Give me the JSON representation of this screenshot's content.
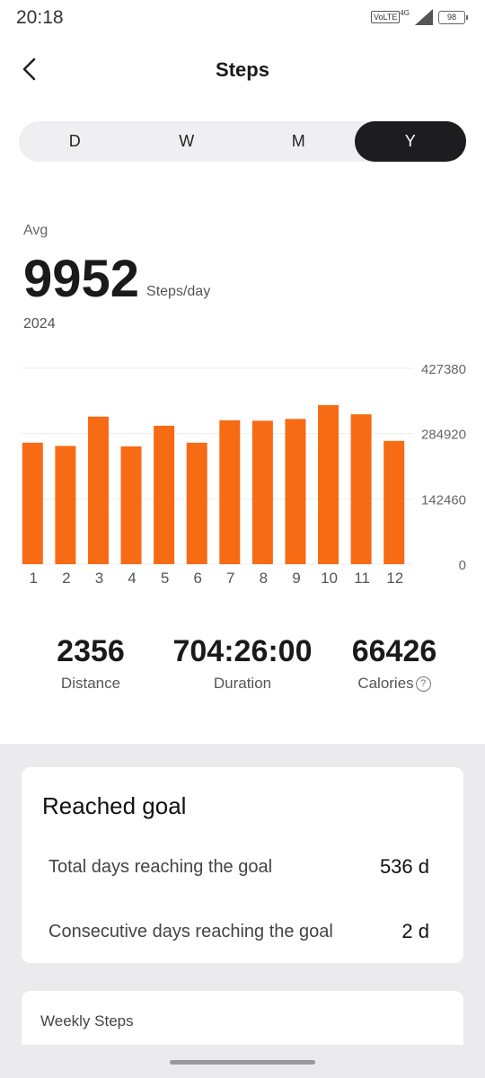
{
  "status": {
    "time": "20:18",
    "volte": "VoLTE",
    "network": "4G",
    "battery": "98"
  },
  "header": {
    "title": "Steps"
  },
  "segments": [
    {
      "label": "D",
      "active": false
    },
    {
      "label": "W",
      "active": false
    },
    {
      "label": "M",
      "active": false
    },
    {
      "label": "Y",
      "active": true
    }
  ],
  "summary": {
    "avg_label": "Avg",
    "avg_value": "9952",
    "unit": "Steps/day",
    "period": "2024"
  },
  "chart_data": {
    "type": "bar",
    "categories": [
      "1",
      "2",
      "3",
      "4",
      "5",
      "6",
      "7",
      "8",
      "9",
      "10",
      "11",
      "12"
    ],
    "values": [
      265000,
      258000,
      322000,
      257000,
      302000,
      265000,
      314000,
      313000,
      317000,
      347000,
      327000,
      269000
    ],
    "yticks": [
      "427380",
      "284920",
      "142460",
      "0"
    ],
    "ylim": [
      0,
      427380
    ],
    "grid": true,
    "bar_color": "#f76b15"
  },
  "stats": [
    {
      "value": "2356",
      "label": "Distance"
    },
    {
      "value": "704:26:00",
      "label": "Duration"
    },
    {
      "value": "66426",
      "label": "Calories",
      "help": "?"
    }
  ],
  "goal_card": {
    "title": "Reached goal",
    "rows": [
      {
        "label": "Total days reaching the goal",
        "value": "536 d"
      },
      {
        "label": "Consecutive days reaching the goal",
        "value": "2 d"
      }
    ]
  },
  "weekly_card": {
    "title": "Weekly Steps"
  }
}
